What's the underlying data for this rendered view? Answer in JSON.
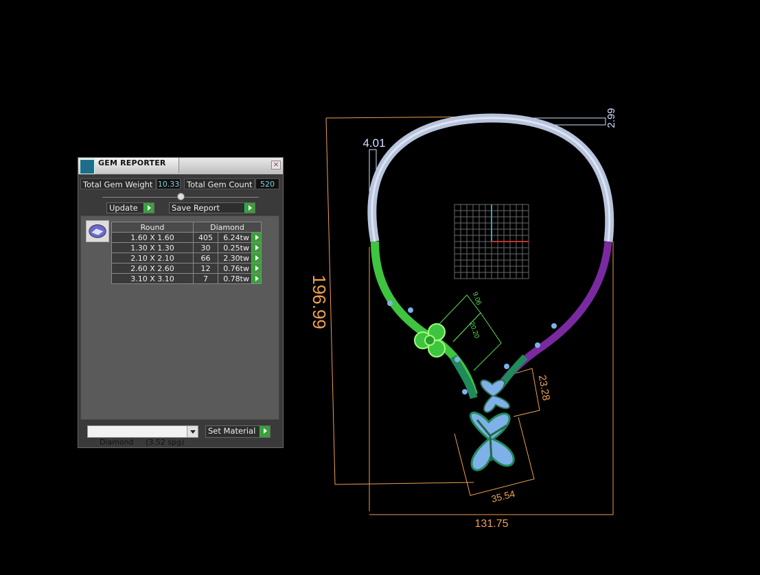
{
  "panel": {
    "title": "GEM REPORTER",
    "close_icon": "close-icon",
    "total_weight_label": "Total Gem Weight",
    "total_weight_value": "10.33",
    "total_count_label": "Total Gem Count",
    "total_count_value": "520",
    "update_label": "Update",
    "save_report_label": "Save Report",
    "table": {
      "headers": [
        "Round",
        "Diamond"
      ],
      "rows": [
        {
          "size": "1.60 X 1.60",
          "count": "405",
          "weight": "6.24tw"
        },
        {
          "size": "1.30 X 1.30",
          "count": "30",
          "weight": "0.25tw"
        },
        {
          "size": "2.10 X 2.10",
          "count": "66",
          "weight": "2.30tw"
        },
        {
          "size": "2.60 X 2.60",
          "count": "12",
          "weight": "0.76tw"
        },
        {
          "size": "3.10 X 3.10",
          "count": "7",
          "weight": "0.78tw"
        }
      ]
    },
    "material_selected": "Diamond     (3.52 spg)",
    "set_material_label": "Set Material"
  },
  "dimensions": {
    "width": "131.75",
    "height": "196.99",
    "wire_top": "2.99",
    "wire_side": "4.01",
    "pendant": "35.54",
    "flower": "23.28",
    "knot_a": "9.06",
    "knot_b": "20.20"
  },
  "colors": {
    "dimension": "#f0a050",
    "wire_label": "#cfe0ff",
    "green_dim": "#56e056",
    "metal_silver": "#b7c4dc",
    "metal_green": "#3fc43f",
    "metal_purple": "#7a2aa0",
    "gem_blue": "#7fb0e8"
  }
}
